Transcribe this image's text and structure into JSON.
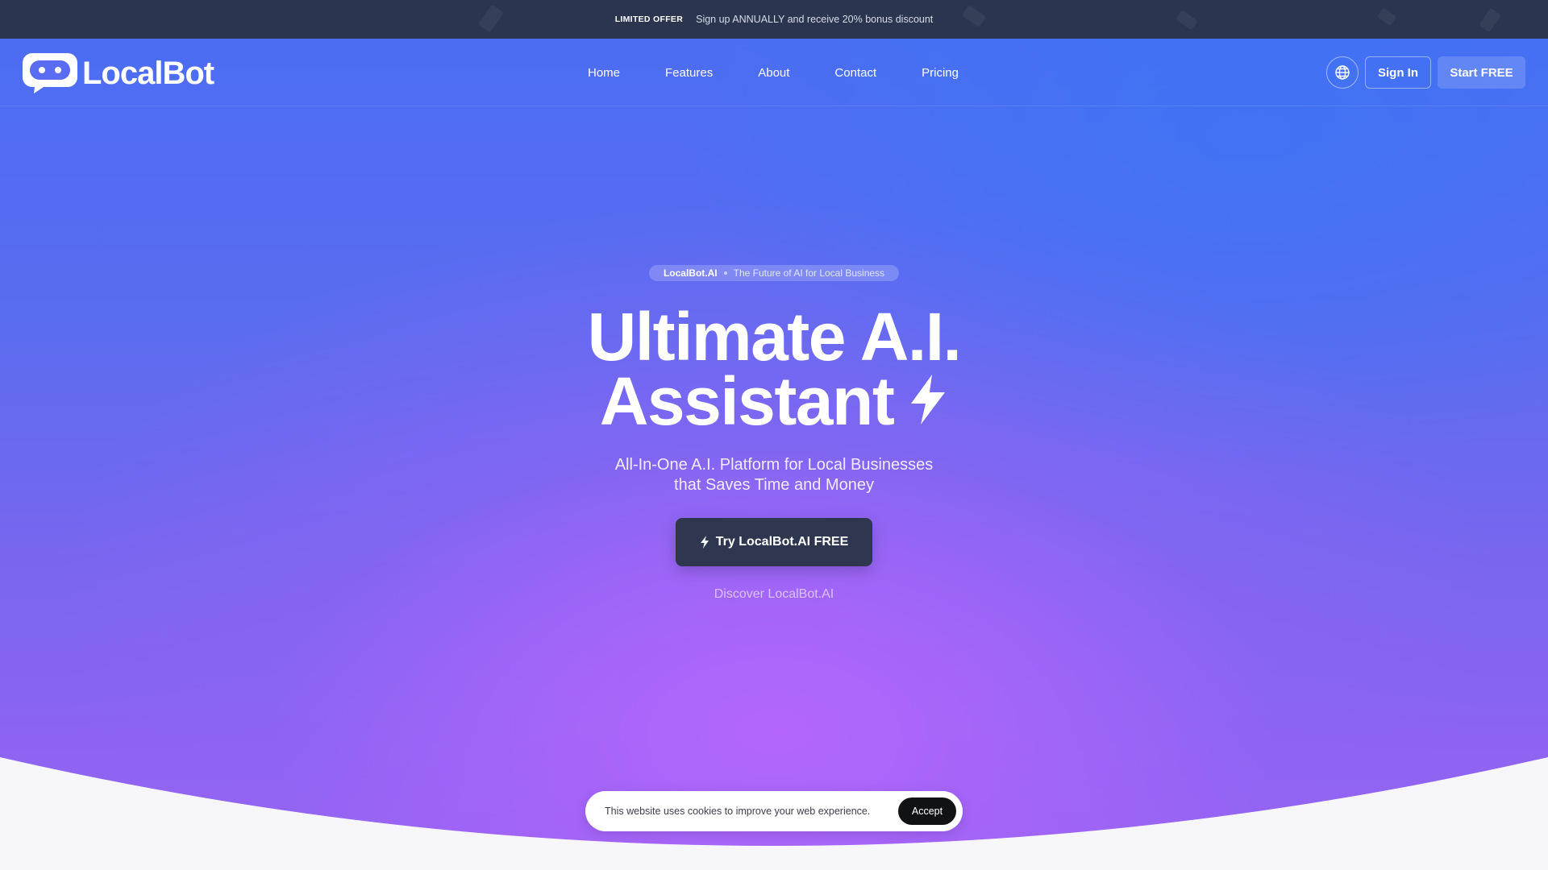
{
  "announcement": {
    "tag": "LIMITED OFFER",
    "text": "Sign up ANNUALLY and receive 20% bonus discount"
  },
  "nav": {
    "logo_text": "LocalBot",
    "links": [
      "Home",
      "Features",
      "About",
      "Contact",
      "Pricing"
    ],
    "globe_icon": "globe-icon",
    "sign_in": "Sign In",
    "start_free": "Start FREE"
  },
  "hero": {
    "pill_brand": "LocalBot.AI",
    "pill_text": "The Future of AI for Local Business",
    "headline_line1": "Ultimate A.I.",
    "headline_line2": "Assistant",
    "headline_icon": "lightning-bolt-icon",
    "subtitle_line1": "All-In-One A.I. Platform for Local Businesses",
    "subtitle_line2": "that Saves Time and Money",
    "cta_label": "Try LocalBot.AI FREE",
    "cta_icon": "lightning-bolt-icon",
    "discover_link": "Discover LocalBot.AI"
  },
  "cookie_banner": {
    "text": "This website uses cookies to improve your web experience.",
    "accept": "Accept"
  },
  "colors": {
    "announcement_bg": "#2c3550",
    "hero_top": "#4b6df2",
    "hero_bottom": "#9a63f3",
    "cta_bg": "#2e3650",
    "accept_bg": "#111216",
    "page_bottom": "#f7f7fb"
  }
}
